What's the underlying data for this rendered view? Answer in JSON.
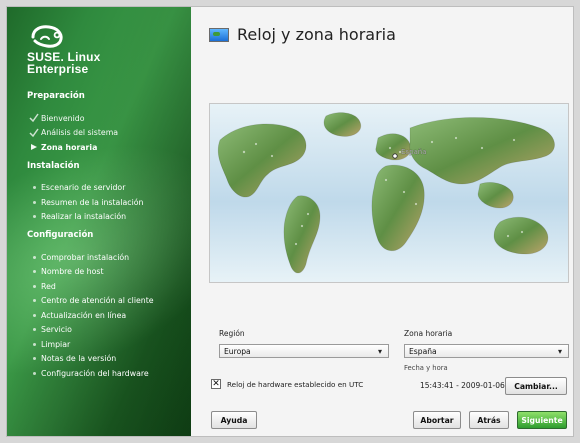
{
  "brand": {
    "line1": "SUSE. Linux",
    "line2": "Enterprise"
  },
  "sidebar": {
    "groups": [
      {
        "title": "Preparación",
        "items": [
          {
            "label": "Bienvenido",
            "state": "done"
          },
          {
            "label": "Análisis del sistema",
            "state": "done"
          },
          {
            "label": "Zona horaria",
            "state": "current"
          }
        ]
      },
      {
        "title": "Instalación",
        "items": [
          {
            "label": "Escenario de servidor",
            "state": "pending"
          },
          {
            "label": "Resumen de la instalación",
            "state": "pending"
          },
          {
            "label": "Realizar la instalación",
            "state": "pending"
          }
        ]
      },
      {
        "title": "Configuración",
        "items": [
          {
            "label": "Comprobar instalación",
            "state": "pending"
          },
          {
            "label": "Nombre de host",
            "state": "pending"
          },
          {
            "label": "Red",
            "state": "pending"
          },
          {
            "label": "Centro de atención al cliente",
            "state": "pending"
          },
          {
            "label": "Actualización en línea",
            "state": "pending"
          },
          {
            "label": "Servicio",
            "state": "pending"
          },
          {
            "label": "Limpiar",
            "state": "pending"
          },
          {
            "label": "Notas de la versión",
            "state": "pending"
          },
          {
            "label": "Configuración del hardware",
            "state": "pending"
          }
        ]
      }
    ]
  },
  "main": {
    "title": "Reloj y zona horaria",
    "map": {
      "label": "España"
    },
    "region": {
      "label": "Región",
      "value": "Europa"
    },
    "timezone": {
      "label": "Zona horaria",
      "value": "España"
    },
    "utc_checkbox": {
      "label": "Reloj de hardware establecido en UTC",
      "checked": true
    },
    "datetime": {
      "label": "Fecha y hora",
      "value": "15:43:41 - 2009-01-06"
    },
    "buttons": {
      "change": "Cambiar...",
      "help": "Ayuda",
      "abort": "Abortar",
      "back": "Atrás",
      "next": "Siguiente"
    }
  }
}
